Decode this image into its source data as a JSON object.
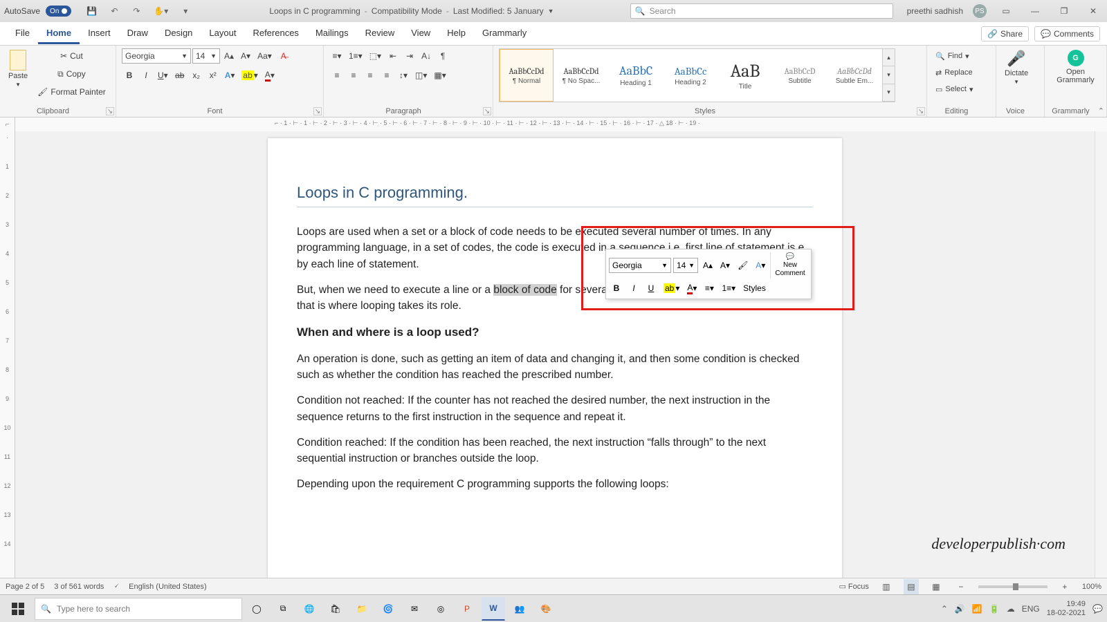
{
  "titlebar": {
    "autosave_label": "AutoSave",
    "autosave_state": "On",
    "doc_name": "Loops in C programming",
    "mode": "Compatibility Mode",
    "last_modified": "Last Modified: 5 January",
    "search_placeholder": "Search",
    "user_name": "preethi sadhish",
    "user_initials": "PS"
  },
  "tabs": {
    "items": [
      "File",
      "Home",
      "Insert",
      "Draw",
      "Design",
      "Layout",
      "References",
      "Mailings",
      "Review",
      "View",
      "Help",
      "Grammarly"
    ],
    "active": "Home",
    "share": "Share",
    "comments": "Comments"
  },
  "ribbon": {
    "clipboard": {
      "label": "Clipboard",
      "paste": "Paste",
      "cut": "Cut",
      "copy": "Copy",
      "format_painter": "Format Painter"
    },
    "font": {
      "label": "Font",
      "name": "Georgia",
      "size": "14"
    },
    "paragraph": {
      "label": "Paragraph"
    },
    "styles": {
      "label": "Styles",
      "items": [
        {
          "preview": "AaBbCcDd",
          "name": "¶ Normal",
          "sel": true,
          "pclass": "p-normal"
        },
        {
          "preview": "AaBbCcDd",
          "name": "¶ No Spac...",
          "pclass": "p-normal"
        },
        {
          "preview": "AaBbC",
          "name": "Heading 1",
          "pclass": "p-h1"
        },
        {
          "preview": "AaBbCc",
          "name": "Heading 2",
          "pclass": "p-h2"
        },
        {
          "preview": "AaB",
          "name": "Title",
          "pclass": "p-title"
        },
        {
          "preview": "AaBbCcD",
          "name": "Subtitle",
          "pclass": "p-sub"
        },
        {
          "preview": "AaBbCcDd",
          "name": "Subtle Em...",
          "pclass": "p-sub2"
        }
      ]
    },
    "editing": {
      "label": "Editing",
      "find": "Find",
      "replace": "Replace",
      "select": "Select"
    },
    "voice": {
      "label": "Voice",
      "dictate": "Dictate"
    },
    "grammarly": {
      "label": "Grammarly",
      "open": "Open Grammarly"
    }
  },
  "document": {
    "title": "Loops in C programming.",
    "p1": "Loops are used when a set or a block of code needs to be executed several number of times. In any programming language, in a set of codes, the code is executed in a sequence i.e. first line of statement is e",
    "p1b": "by each line of statement.",
    "p2a": "But, when we need to execute a line or a ",
    "p2hl": "block of code",
    "p2b": " for several times until a certain condition is satisfied, that is where looping takes its role.",
    "h2": "When and where is a loop used?",
    "p3": "An operation is done, such as getting an item of data and changing it, and then some condition is checked such as whether the condition has reached the prescribed number.",
    "p4": "Condition not reached: If the counter has not reached the desired number, the next instruction in the sequence returns to the first instruction in the sequence and repeat it.",
    "p5": "Condition reached: If the condition has been reached, the next instruction “falls through” to the next sequential instruction or branches outside the loop.",
    "p6": "Depending upon the requirement C programming supports the following loops:"
  },
  "mini_toolbar": {
    "font": "Georgia",
    "size": "14",
    "styles": "Styles",
    "new_comment_l1": "New",
    "new_comment_l2": "Comment"
  },
  "statusbar": {
    "page": "Page 2 of 5",
    "words": "3 of 561 words",
    "lang": "English (United States)",
    "focus": "Focus",
    "zoom": "100%"
  },
  "taskbar": {
    "search_placeholder": "Type here to search",
    "lang": "ENG",
    "time": "19:49",
    "date": "18-02-2021"
  },
  "watermark": "developerpublish·com",
  "ruler_h": "⌐ · 1 · ⊢ · 1 · ⊢ · 2 · ⊢ · 3 · ⊢ · 4 · ⊢ · 5 · ⊢ · 6 · ⊢ · 7 · ⊢ · 8 · ⊢ · 9 · ⊢ · 10 · ⊢ · 11 · ⊢ · 12 · ⊢ · 13 · ⊢ · 14 · ⊢ · 15 · ⊢ · 16 · ⊢ · 17 · △ 18 · ⊢ · 19 ·"
}
